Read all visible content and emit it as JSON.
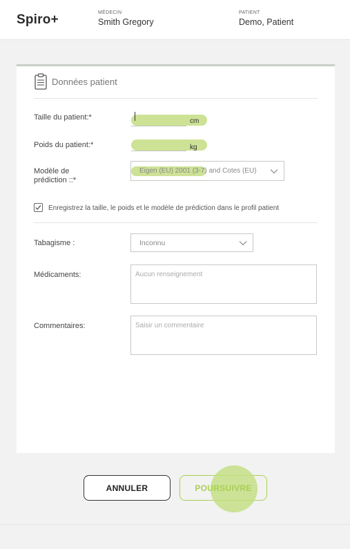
{
  "header": {
    "brand": "Spiro+",
    "doctor_label": "MÉDECIN",
    "doctor_name": "Smith Gregory",
    "patient_label": "PATIENT",
    "patient_name": "Demo, Patient"
  },
  "card": {
    "title": "Données patient",
    "height_label": "Taille du patient:*",
    "height_value": "",
    "height_unit": "cm",
    "weight_label": "Poids du patient:*",
    "weight_value": "",
    "weight_unit": "kg",
    "model_label_line1": "Modèle de",
    "model_label_line2": "prédiction ::*",
    "model_value": "Eigen (EU) 2001 (3-7) and Cotes (EU)",
    "save_checkbox_checked": true,
    "save_checkbox_label": "Enregistrez la taille, le poids et le modèle de prédiction dans le profil patient",
    "smoking_label": "Tabagisme :",
    "smoking_value": "Inconnu",
    "meds_label": "Médicaments:",
    "meds_placeholder": "Aucun renseignement",
    "comments_label": "Commentaires:",
    "comments_placeholder": "Saisir un commentaire"
  },
  "actions": {
    "cancel_label": "ANNULER",
    "next_label": "POURSUIVRE"
  },
  "colors": {
    "accent": "#a9cf55",
    "highlight": "#c8df8a",
    "background": "#f1f2f1"
  },
  "icons": [
    "clipboard-icon",
    "chevron-down-icon",
    "checkmark-icon"
  ]
}
